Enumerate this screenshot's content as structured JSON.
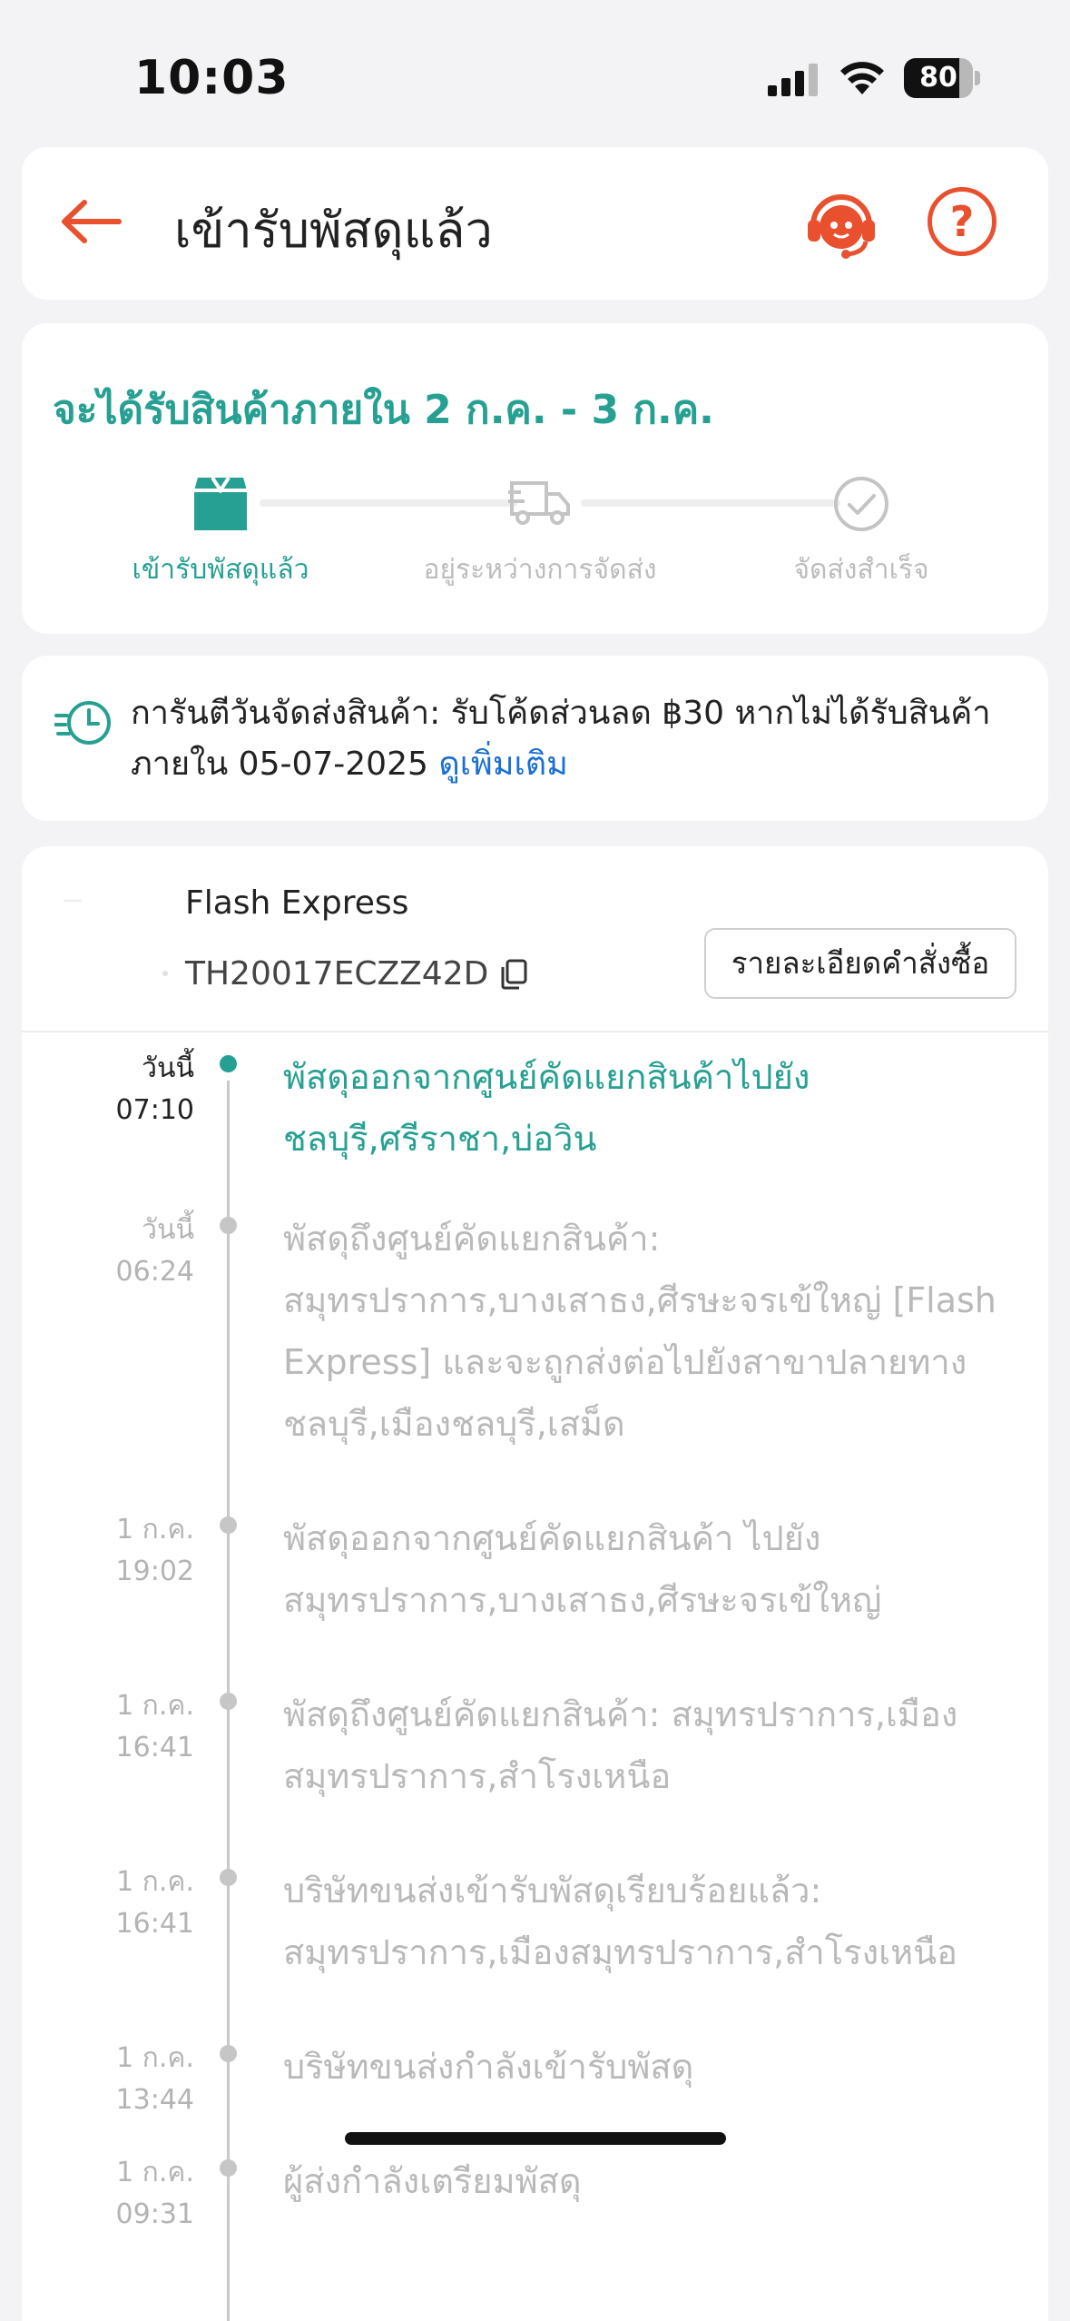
{
  "status_bar": {
    "time": "10:03",
    "battery": "80",
    "battery_level": 0.8
  },
  "header": {
    "title": "เข้ารับพัสดุแล้ว",
    "back_icon": "arrow-left-icon",
    "support_icon": "headset-support-icon",
    "help_icon": "question-circle-icon",
    "help_glyph": "?"
  },
  "progress": {
    "eta": "จะได้รับสินค้าภายใน 2 ก.ค. - 3 ก.ค.",
    "steps": [
      {
        "label": "เข้ารับพัสดุแล้ว",
        "icon": "package-icon",
        "active": true
      },
      {
        "label": "อยู่ระหว่างการจัดส่ง",
        "icon": "truck-icon",
        "active": false
      },
      {
        "label": "จัดส่งสำเร็จ",
        "icon": "check-circle-icon",
        "active": false
      }
    ]
  },
  "guarantee": {
    "text": "การันตีวันจัดส่งสินค้า: รับโค้ดส่วนลด ฿30 หากไม่ได้รับสินค้าภายใน 05-07-2025 ",
    "link": "ดูเพิ่มเติม",
    "icon": "clock-fast-icon"
  },
  "shipment": {
    "courier": "Flash Express",
    "tracking_number": "TH20017ECZZ42D",
    "order_detail_button": "รายละเอียดคำสั่งซื้อ",
    "events": [
      {
        "date": "วันนี้",
        "time": "07:10",
        "text": "พัสดุออกจากศูนย์คัดแยกสินค้าไปยัง ชลบุรี,ศรีราชา,บ่อวิน",
        "active": true
      },
      {
        "date": "วันนี้",
        "time": "06:24",
        "text": "พัสดุถึงศูนย์คัดแยกสินค้า: สมุทรปราการ,บางเสาธง,ศีรษะจรเข้ใหญ่ [Flash Express] และจะถูกส่งต่อไปยังสาขาปลายทาง ชลบุรี,เมืองชลบุรี,เสม็ด",
        "active": false
      },
      {
        "date": "1 ก.ค.",
        "time": "19:02",
        "text": "พัสดุออกจากศูนย์คัดแยกสินค้า ไปยัง สมุทรปราการ,บางเสาธง,ศีรษะจรเข้ใหญ่",
        "active": false
      },
      {
        "date": "1 ก.ค.",
        "time": "16:41",
        "text": "พัสดุถึงศูนย์คัดแยกสินค้า: สมุทรปราการ,เมืองสมุทรปราการ,สำโรงเหนือ",
        "active": false
      },
      {
        "date": "1 ก.ค.",
        "time": "16:41",
        "text": "บริษัทขนส่งเข้ารับพัสดุเรียบร้อยแล้ว: สมุทรปราการ,เมืองสมุทรปราการ,สำโรงเหนือ",
        "active": false
      },
      {
        "date": "1 ก.ค.",
        "time": "13:44",
        "text": "บริษัทขนส่งกำลังเข้ารับพัสดุ",
        "active": false
      },
      {
        "date": "1 ก.ค.",
        "time": "09:31",
        "text": "ผู้ส่งกำลังเตรียมพัสดุ",
        "active": false
      }
    ]
  },
  "colors": {
    "accent_orange": "#e8502e",
    "teal": "#26a092",
    "link_blue": "#1a6fd1"
  }
}
